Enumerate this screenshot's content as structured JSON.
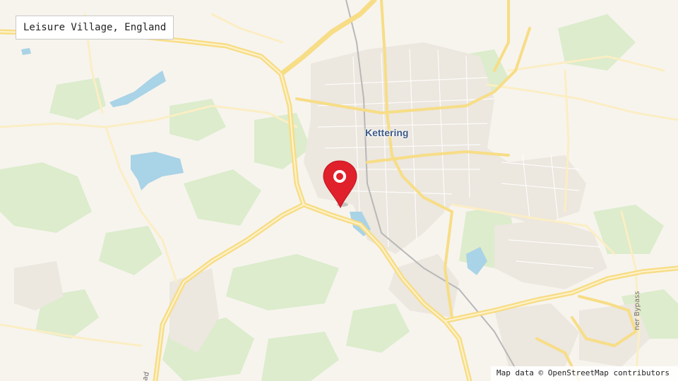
{
  "map": {
    "title": "Leisure Village, England",
    "place_label": "Kettering",
    "road_labels": [
      "ner Bypass",
      "ad"
    ],
    "attribution": "Map data © OpenStreetMap contributors",
    "marker": {
      "icon": "map-pin-icon",
      "color": "#e0202a"
    },
    "colors": {
      "land": "#f7f4ee",
      "green": "#dceccc",
      "water": "#a9d3e6",
      "urban": "#ece7df",
      "major_road": "#f7dd86",
      "minor_road": "#fbeec4",
      "rail": "#b8b8b8",
      "label": "#3e5a87"
    }
  }
}
